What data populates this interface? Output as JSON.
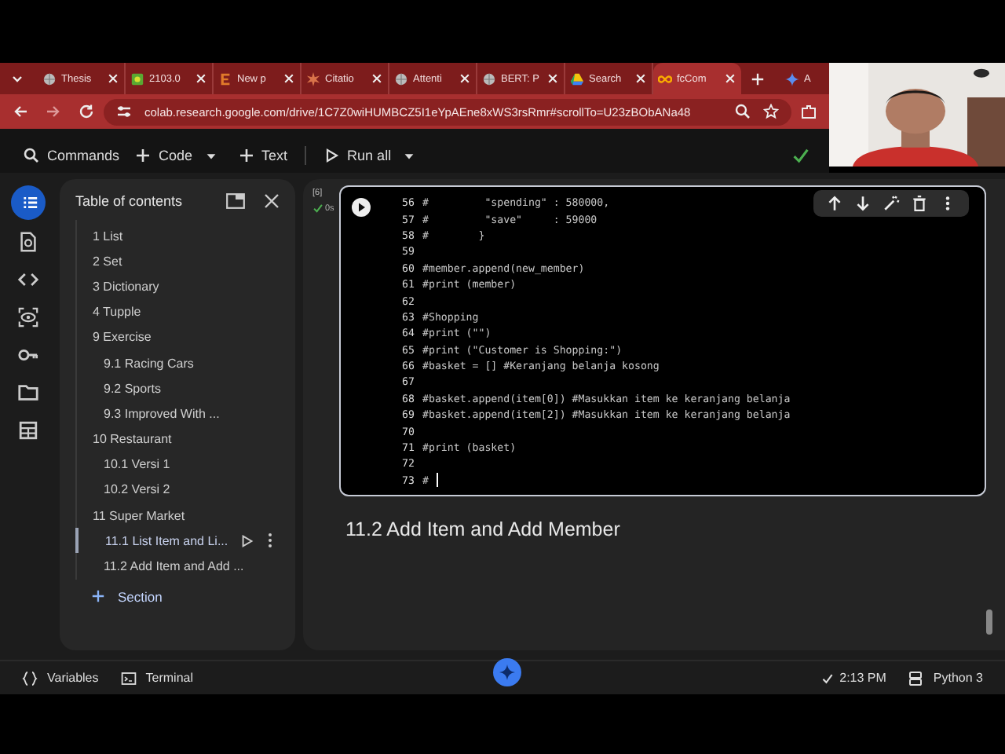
{
  "browser": {
    "tabs": [
      {
        "title": "Thesis",
        "kind": "globe",
        "selected": false
      },
      {
        "title": "2103.0",
        "kind": "square",
        "selected": false
      },
      {
        "title": "New p",
        "kind": "letter",
        "selected": false
      },
      {
        "title": "Citatio",
        "kind": "burst",
        "selected": false
      },
      {
        "title": "Attenti",
        "kind": "globe",
        "selected": false
      },
      {
        "title": "BERT: P",
        "kind": "globe",
        "selected": false
      },
      {
        "title": "Search",
        "kind": "drive",
        "selected": false
      },
      {
        "title": "fcCom",
        "kind": "infinity",
        "selected": true
      },
      {
        "title": "A",
        "kind": "sparkle",
        "selected": false
      }
    ],
    "url": "colab.research.google.com/drive/1C7Z0wiHUMBCZ5I1eYpAEne8xWS3rsRmr#scrollTo=U23zBObANa48"
  },
  "toolbar": {
    "buttons": [
      {
        "label": "Commands",
        "kind": "search"
      },
      {
        "label": "Code",
        "kind": "add-caret"
      },
      {
        "label": "Text",
        "kind": "add"
      },
      {
        "label": "Run all",
        "kind": "run-caret"
      }
    ],
    "saved": true
  },
  "sidebar": {
    "rail": [
      {
        "kind": "toc",
        "selected": true
      },
      {
        "kind": "find",
        "selected": false
      },
      {
        "kind": "code",
        "selected": false
      },
      {
        "kind": "variables",
        "selected": false
      },
      {
        "kind": "key",
        "selected": false
      },
      {
        "kind": "folder",
        "selected": false
      },
      {
        "kind": "table",
        "selected": false
      }
    ],
    "toc": {
      "title": "Table of contents",
      "items": [
        {
          "label": "1 List",
          "selected": false
        },
        {
          "label": "2 Set",
          "selected": false
        },
        {
          "label": "3 Dictionary",
          "selected": false
        },
        {
          "label": "4 Tupple",
          "selected": false
        },
        {
          "label": "9 Exercise",
          "selected": false,
          "children": [
            {
              "label": "9.1 Racing Cars",
              "selected": false
            },
            {
              "label": "9.2 Sports",
              "selected": false
            },
            {
              "label": "9.3 Improved With ...",
              "selected": false
            }
          ]
        },
        {
          "label": "10 Restaurant",
          "selected": false,
          "children": [
            {
              "label": "10.1 Versi 1",
              "selected": false
            },
            {
              "label": "10.2 Versi 2",
              "selected": false
            }
          ]
        },
        {
          "label": "11 Super Market",
          "selected": false,
          "children": [
            {
              "label": "11.1 List Item and Li...",
              "selected": true
            },
            {
              "label": "11.2 Add Item and Add ...",
              "selected": false
            }
          ]
        }
      ],
      "add_section": "Section"
    }
  },
  "cell": {
    "execution_count": "[6]",
    "duration": "0s",
    "lines": [
      {
        "number": "56",
        "code": "#         \"spending\" : 580000,"
      },
      {
        "number": "57",
        "code": "#         \"save\"     : 59000"
      },
      {
        "number": "58",
        "code": "#        }"
      },
      {
        "number": "59"
      },
      {
        "number": "60",
        "code": "#member.append(new_member)"
      },
      {
        "number": "61",
        "code": "#print (member)"
      },
      {
        "number": "62"
      },
      {
        "number": "63",
        "code": "#Shopping"
      },
      {
        "number": "64",
        "code": "#print (\"\")"
      },
      {
        "number": "65",
        "code": "#print (\"Customer is Shopping:\")"
      },
      {
        "number": "66",
        "code": "#basket = [] #Keranjang belanja kosong"
      },
      {
        "number": "67"
      },
      {
        "number": "68",
        "code": "#basket.append(item[0]) #Masukkan item ke keranjang belanja"
      },
      {
        "number": "69",
        "code": "#basket.append(item[2]) #Masukkan item ke keranjang belanja"
      },
      {
        "number": "70"
      },
      {
        "number": "71",
        "code": "#print (basket)"
      },
      {
        "number": "72"
      },
      {
        "number": "73",
        "code": "#"
      }
    ]
  },
  "heading": "11.2 Add Item and Add Member",
  "status_bar": {
    "variables": "Variables",
    "terminal": "Terminal",
    "time": "2:13 PM",
    "runtime": "Python 3"
  }
}
